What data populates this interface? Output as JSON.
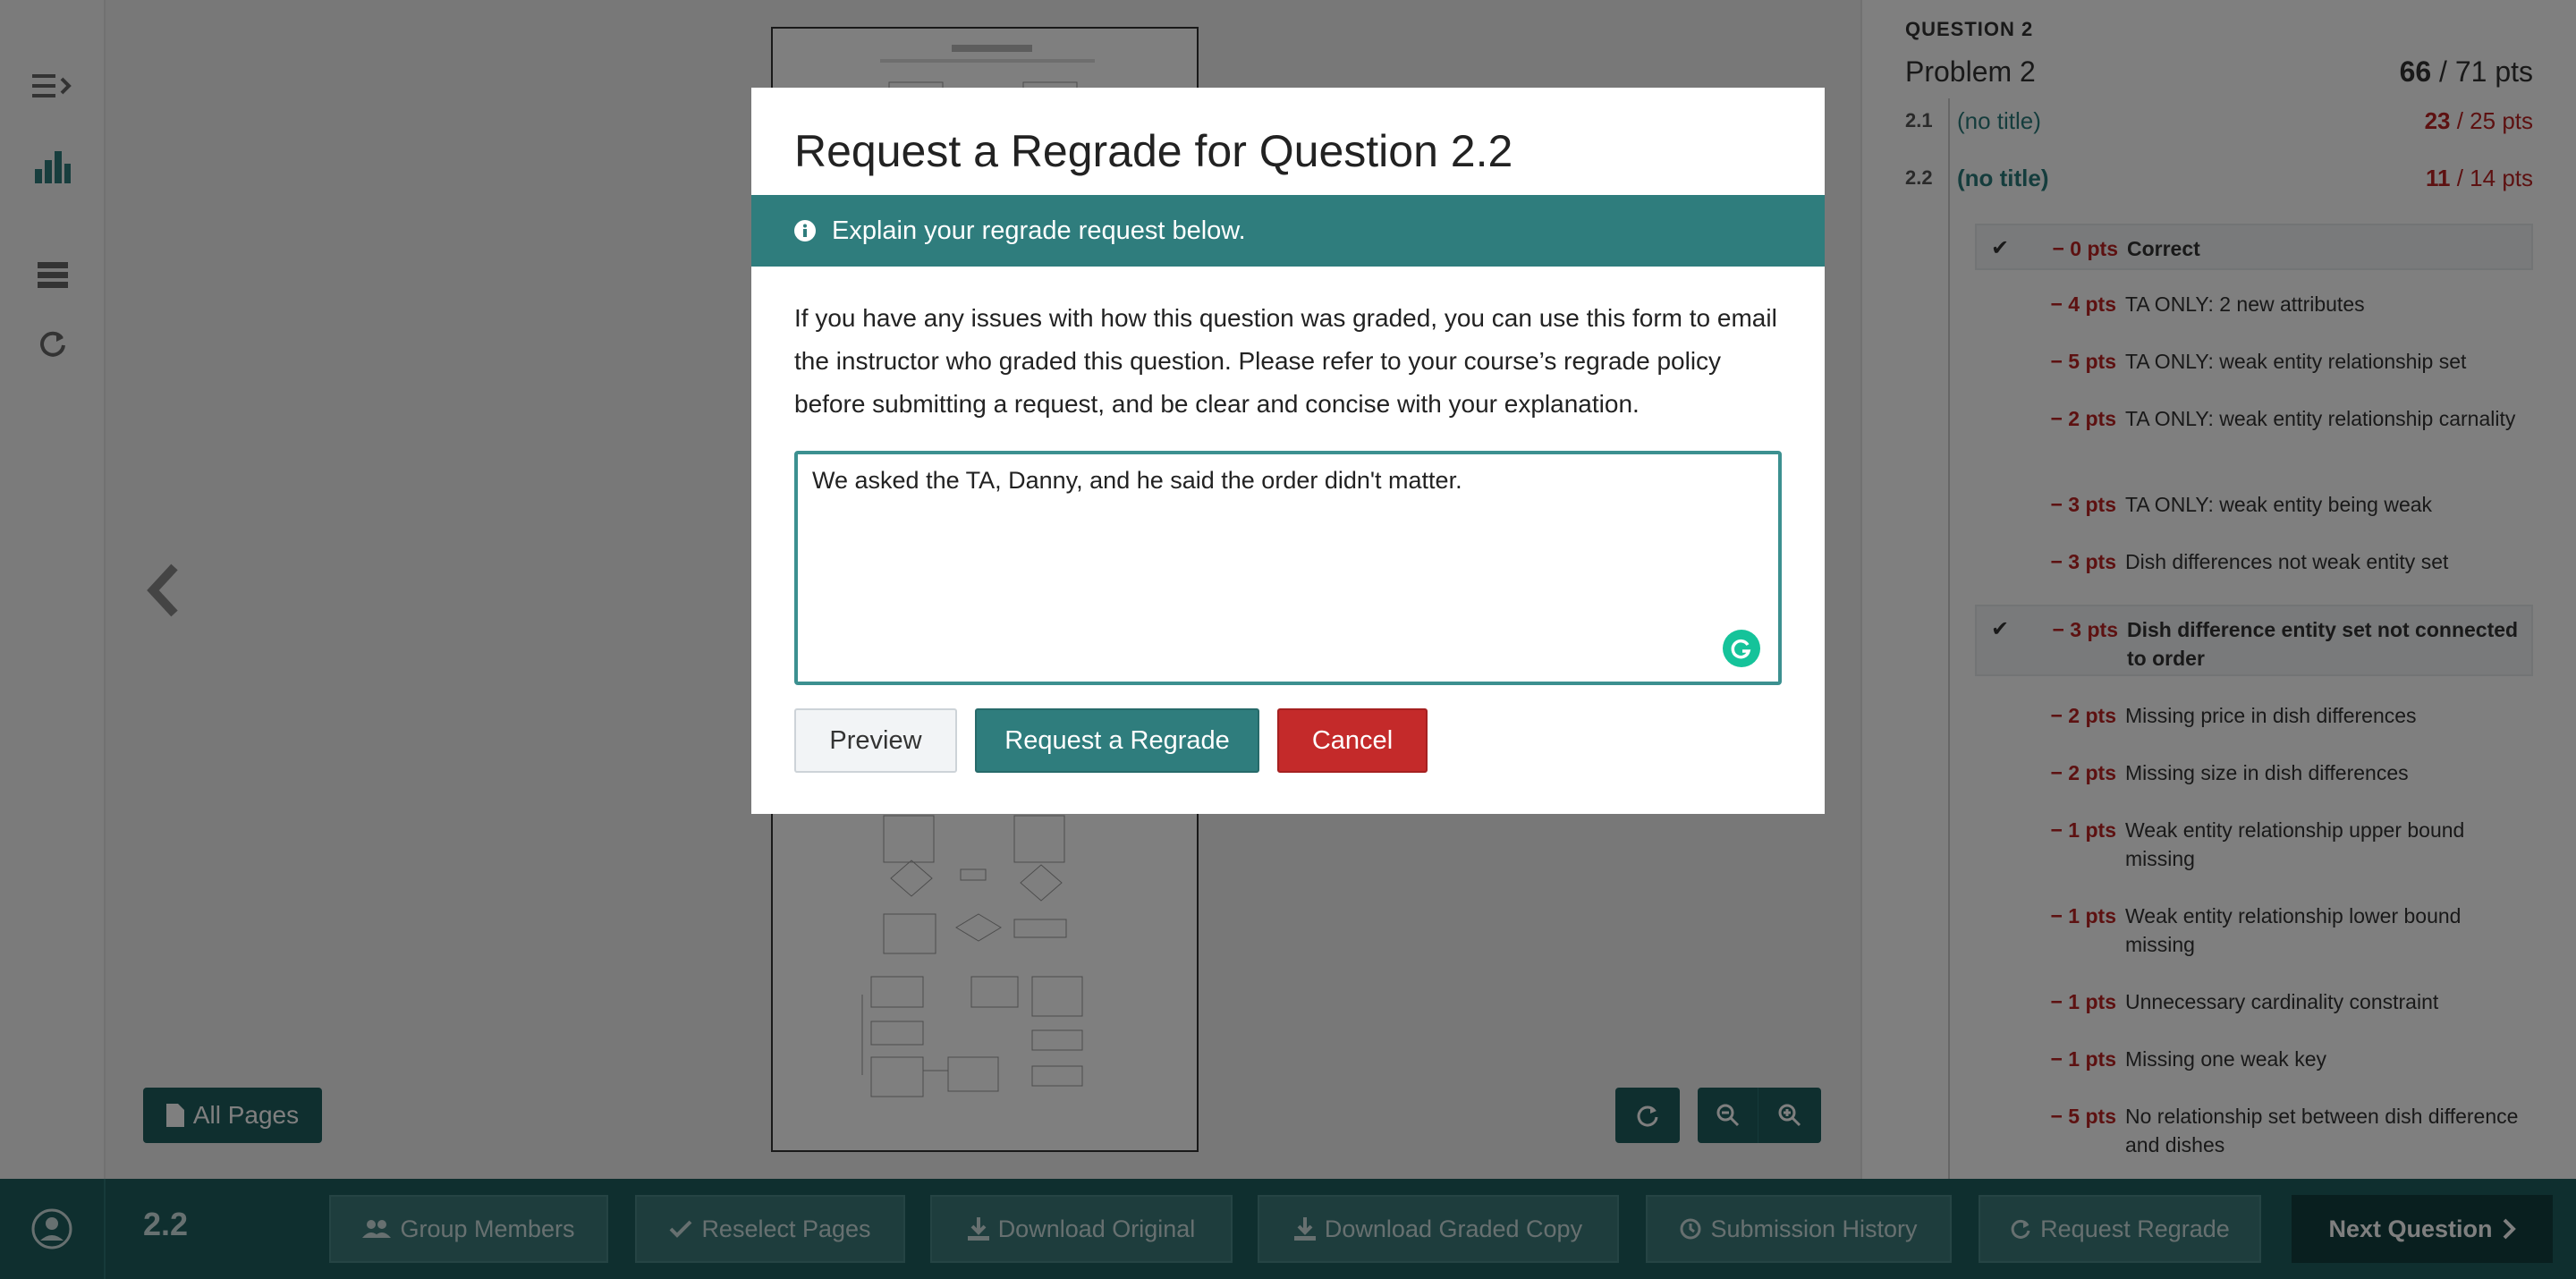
{
  "sidebar": {
    "icons": [
      "menu-expand-icon",
      "bar-chart-icon",
      "outline-icon",
      "refresh-icon"
    ]
  },
  "main": {
    "all_pages_label": "All Pages"
  },
  "panel": {
    "question_label": "QUESTION 2",
    "problem_title": "Problem 2",
    "problem_score": "66",
    "problem_total": " / 71 pts",
    "subquestions": [
      {
        "number": "2.1",
        "title": "(no title)",
        "score": "23",
        "total": " / 25 pts"
      },
      {
        "number": "2.2",
        "title": "(no title)",
        "score": "11",
        "total": " / 14 pts"
      }
    ],
    "rubric": [
      {
        "pts": "− 0 pts",
        "desc": "Correct",
        "applied": true
      },
      {
        "pts": "− 4 pts",
        "desc": "TA ONLY: 2 new attributes",
        "applied": false
      },
      {
        "pts": "− 5 pts",
        "desc": "TA ONLY: weak entity relationship set",
        "applied": false
      },
      {
        "pts": "− 2 pts",
        "desc": "TA ONLY: weak entity relationship carnality",
        "applied": false
      },
      {
        "pts": "− 3 pts",
        "desc": "TA ONLY: weak entity being weak",
        "applied": false
      },
      {
        "pts": "− 3 pts",
        "desc": "Dish differences not weak entity set",
        "applied": false
      },
      {
        "pts": "− 3 pts",
        "desc": "Dish difference entity set not connected to order",
        "applied": true
      },
      {
        "pts": "− 2 pts",
        "desc": "Missing price in dish differences",
        "applied": false
      },
      {
        "pts": "− 2 pts",
        "desc": "Missing size in dish differences",
        "applied": false
      },
      {
        "pts": "− 1 pts",
        "desc": "Weak entity relationship upper bound missing",
        "applied": false
      },
      {
        "pts": "− 1 pts",
        "desc": "Weak entity relationship lower bound missing",
        "applied": false
      },
      {
        "pts": "− 1 pts",
        "desc": "Unnecessary cardinality constraint",
        "applied": false
      },
      {
        "pts": "− 1 pts",
        "desc": "Missing one weak key",
        "applied": false
      },
      {
        "pts": "− 5 pts",
        "desc": "No relationship set between dish difference and dishes",
        "applied": false
      }
    ]
  },
  "bottom_bar": {
    "question_number": "2.2",
    "buttons": [
      {
        "label": "Group Members",
        "icon": "users-icon"
      },
      {
        "label": "Reselect Pages",
        "icon": "check-icon"
      },
      {
        "label": "Download Original",
        "icon": "download-icon"
      },
      {
        "label": "Download Graded Copy",
        "icon": "download-icon"
      },
      {
        "label": "Submission History",
        "icon": "clock-icon"
      },
      {
        "label": "Request Regrade",
        "icon": "refresh-icon"
      }
    ],
    "next_label": "Next Question"
  },
  "modal": {
    "title": "Request a Regrade for Question 2.2",
    "banner": "Explain your regrade request below.",
    "description": "If you have any issues with how this question was graded, you can use this form to email the instructor who graded this question. Please refer to your course’s regrade policy before submitting a request, and be clear and concise with your explanation.",
    "textarea_value": "We asked the TA, Danny, and he said the order didn't matter.",
    "preview_label": "Preview",
    "request_label": "Request a Regrade",
    "cancel_label": "Cancel"
  },
  "colors": {
    "brand": "#1f5e5e",
    "accent": "#2f7d7d",
    "danger": "#c42a2a",
    "deduction": "#b22222",
    "grammar": "#15c39a"
  }
}
